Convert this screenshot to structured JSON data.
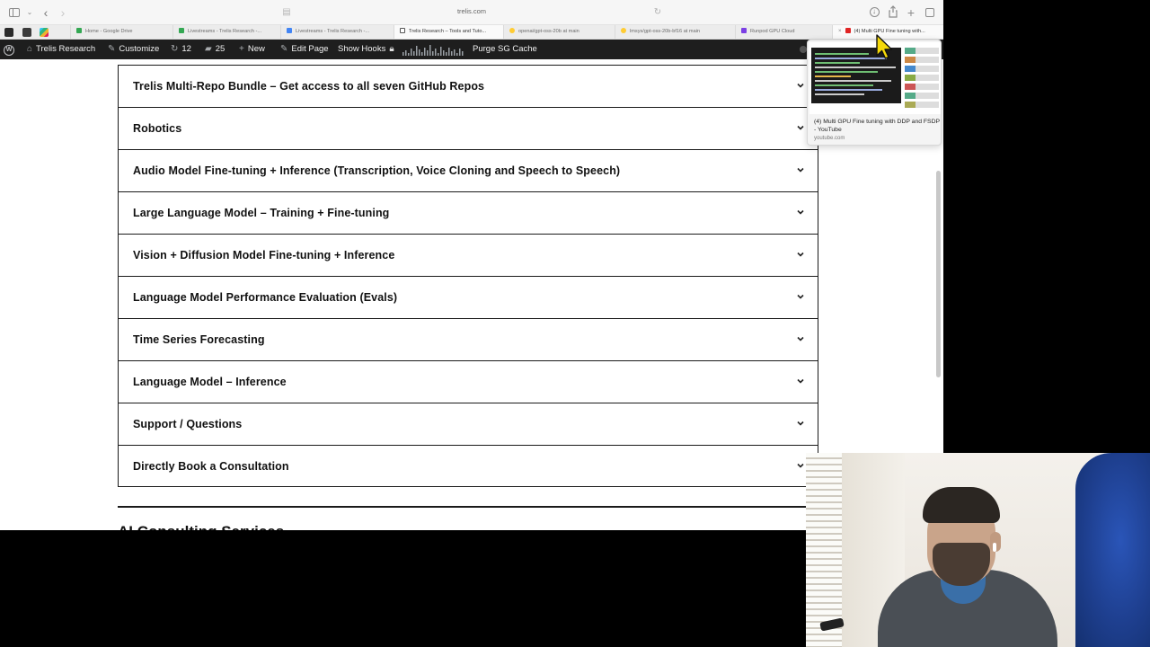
{
  "browser": {
    "url": "trelis.com",
    "tabs": [
      {
        "label": "Home - Google Drive",
        "favicon_color": "#34a853",
        "active": false
      },
      {
        "label": "Livestreams - Trelis Research -...",
        "favicon_color": "#34a853",
        "active": false
      },
      {
        "label": "Livestreams - Trelis Research -...",
        "favicon_color": "#4285f4",
        "active": false
      },
      {
        "label": "Trelis Research – Tools and Tuto...",
        "favicon_color": "#ffffff",
        "active": true
      },
      {
        "label": "openai/gpt-oss-20b at main",
        "favicon_color": "#ffcc33",
        "active": false
      },
      {
        "label": "lmsys/gpt-oss-20b-bf16 at main",
        "favicon_color": "#ffcc33",
        "active": false
      },
      {
        "label": "Runpod GPU Cloud",
        "favicon_color": "#7b3fe4",
        "active": false
      },
      {
        "label": "(4) Multi GPU Fine tuning with...",
        "favicon_color": "#e02424",
        "active": false
      }
    ]
  },
  "adminbar": {
    "site_name": "Trelis Research",
    "customize": "Customize",
    "updates_count": "12",
    "comments_count": "25",
    "new": "New",
    "edit_page": "Edit Page",
    "show_hooks": "Show Hooks",
    "purge": "Purge SG Cache"
  },
  "accordion": {
    "items": [
      "Trelis Multi-Repo Bundle – Get access to all seven GitHub Repos",
      "Robotics",
      "Audio Model Fine-tuning + Inference (Transcription, Voice Cloning and Speech to Speech)",
      "Large Language Model – Training + Fine-tuning",
      "Vision + Diffusion Model Fine-tuning + Inference",
      "Language Model Performance Evaluation (Evals)",
      "Time Series Forecasting",
      "Language Model – Inference",
      "Support / Questions",
      "Directly Book a Consultation"
    ]
  },
  "next_section_heading": "AI Consulting Services",
  "tab_preview": {
    "title": "(4) Multi GPU Fine tuning with DDP and FSDP - YouTube",
    "domain": "youtube.com"
  }
}
